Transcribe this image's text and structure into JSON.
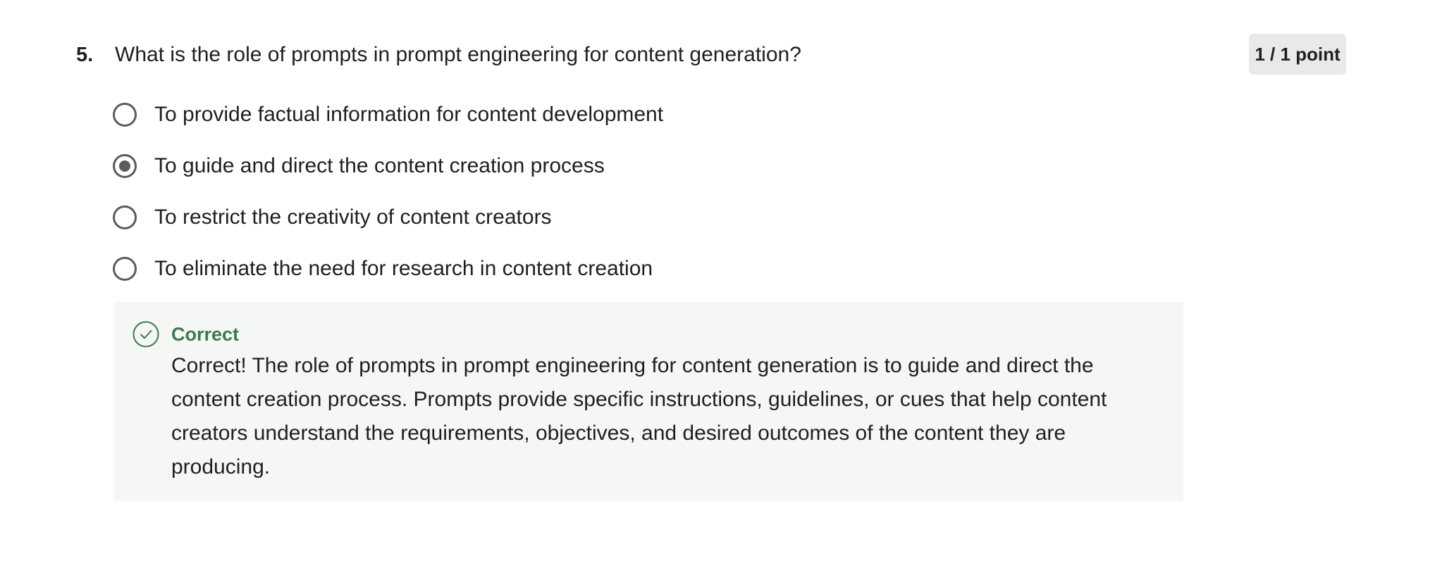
{
  "question": {
    "number": "5.",
    "text": "What is the role of prompts in prompt engineering for content generation?",
    "points": "1 / 1 point"
  },
  "options": [
    {
      "label": "To provide factual information for content development",
      "selected": false
    },
    {
      "label": "To guide and direct the content creation process",
      "selected": true
    },
    {
      "label": "To restrict the creativity of content creators",
      "selected": false
    },
    {
      "label": "To eliminate the need for research in content creation",
      "selected": false
    }
  ],
  "feedback": {
    "status_icon": "check-circle-icon",
    "title": "Correct",
    "text": "Correct! The role of prompts in prompt engineering for content generation is to guide and direct the content creation process. Prompts provide specific instructions, guidelines, or cues that help content creators understand the requirements, objectives, and desired outcomes of the content they are producing."
  },
  "colors": {
    "correct_green": "#3a7a4d",
    "feedback_bg": "#f5f7f5",
    "badge_bg": "#e9e9ea",
    "radio_border": "#5b5b5b"
  }
}
